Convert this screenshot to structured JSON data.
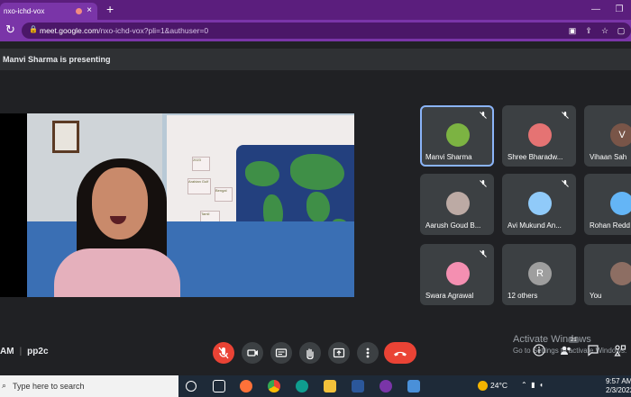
{
  "browser": {
    "tab_title": "nxo-ichd-vox",
    "tab_close": "×",
    "new_tab": "+",
    "window_controls": [
      "—",
      "❐"
    ],
    "url_host": "meet.google.com",
    "url_path": "/nxo-ichd-vox?pli=1&authuser=0"
  },
  "meet": {
    "presenting_banner": "Manvi Sharma is presenting",
    "presentation_stickers": [
      "2023",
      "Arabian Gulf",
      "Bengal",
      "Tamil"
    ],
    "participants": [
      {
        "name": "Manvi Sharma",
        "avatar_color": "#7cb342",
        "initial": "",
        "muted": true,
        "active": true
      },
      {
        "name": "Shree Bharadw...",
        "avatar_color": "#e57373",
        "initial": "",
        "muted": true,
        "active": false
      },
      {
        "name": "Vihaan Sah",
        "avatar_color": "#795548",
        "initial": "V",
        "muted": false,
        "active": false
      },
      {
        "name": "Aarush Goud B...",
        "avatar_color": "#bcaaa4",
        "initial": "",
        "muted": true,
        "active": false
      },
      {
        "name": "Avi Mukund An...",
        "avatar_color": "#90caf9",
        "initial": "",
        "muted": true,
        "active": false
      },
      {
        "name": "Rohan Redd",
        "avatar_color": "#64b5f6",
        "initial": "",
        "muted": false,
        "active": false
      },
      {
        "name": "Swara Agrawal",
        "avatar_color": "#f48fb1",
        "initial": "",
        "muted": true,
        "active": false
      },
      {
        "name": "12 others",
        "avatar_color": "#9e9e9e",
        "initial": "R",
        "muted": false,
        "active": false
      },
      {
        "name": "You",
        "avatar_color": "#8d6e63",
        "initial": "",
        "muted": false,
        "active": false
      }
    ],
    "time_fragment": "AM",
    "meeting_code": "pp2c",
    "people_count": "21"
  },
  "os": {
    "activate_title": "Activate Windows",
    "activate_sub": "Go to Settings to activate Windows.",
    "search_placeholder": "Type here to search",
    "temperature": "24°C",
    "time": "9:57 AM",
    "date": "2/3/2022"
  },
  "colors": {
    "browser_frame": "#5b1e7d",
    "toolbar": "#7a35a8",
    "meet_bg": "#202124",
    "danger": "#ea4335",
    "active_outline": "#8ab4f8"
  }
}
